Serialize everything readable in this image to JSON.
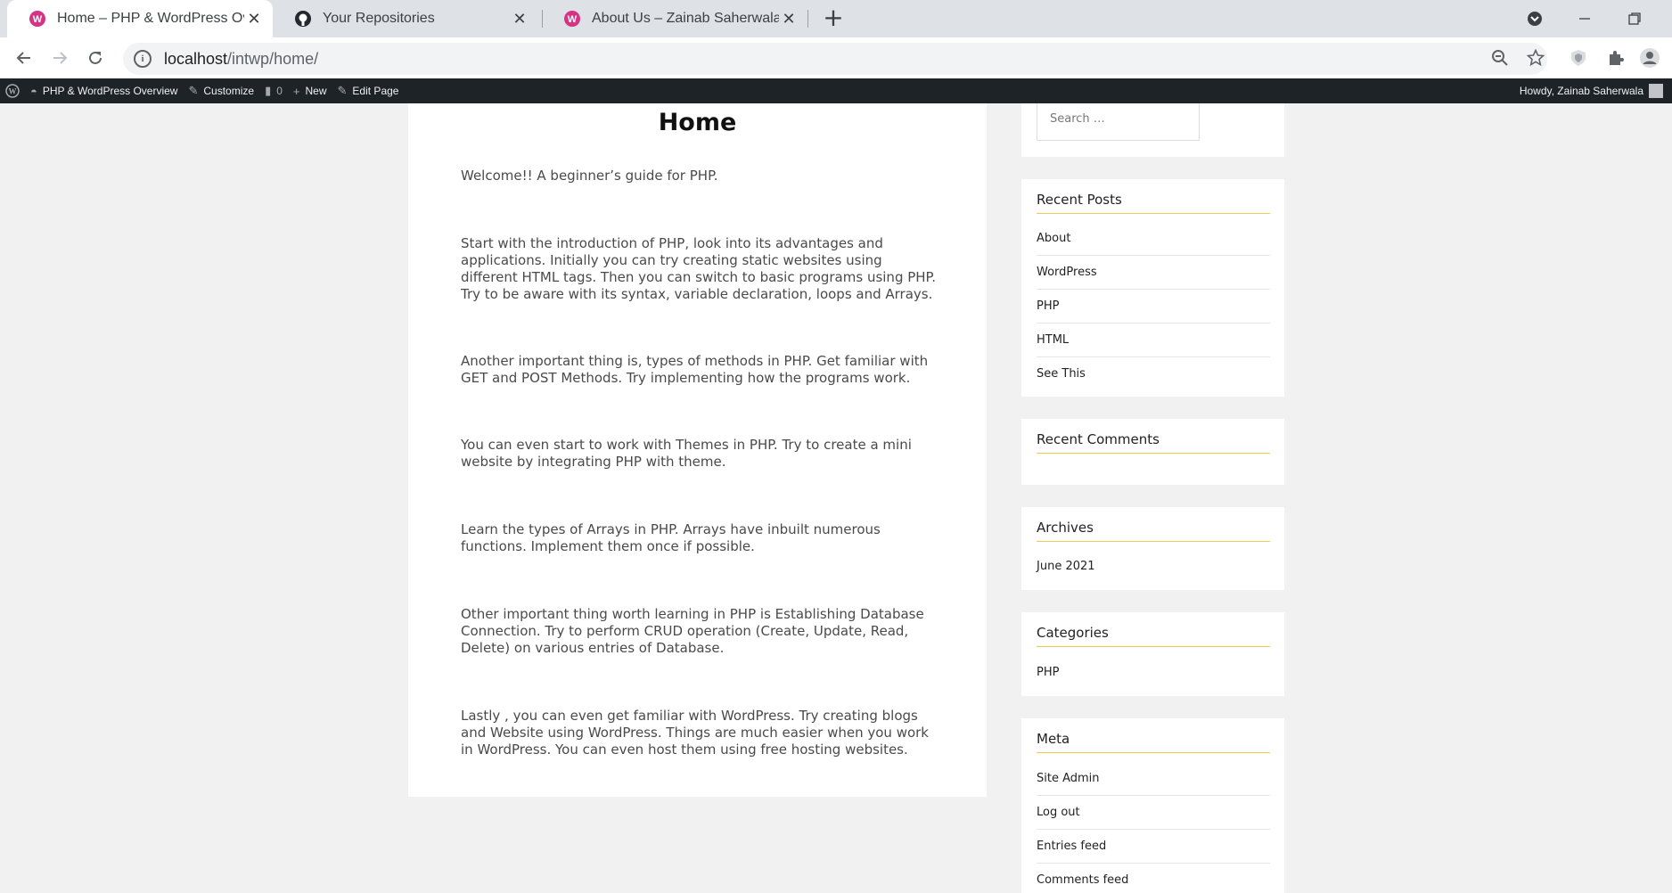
{
  "browser": {
    "tabs": [
      {
        "title": "Home – PHP & WordPress Overview",
        "icon": "wordpress-favicon-icon",
        "active": true
      },
      {
        "title": "Your Repositories",
        "icon": "github-icon",
        "active": false
      },
      {
        "title": "About Us – Zainab Saherwala",
        "icon": "wordpress-favicon-icon",
        "active": false
      }
    ],
    "url_host": "localhost",
    "url_path": "/intwp/home/",
    "accent_color": "#d63384"
  },
  "adminbar": {
    "site_name": "PHP & WordPress Overview",
    "customize": "Customize",
    "comments_count": "0",
    "new": "New",
    "edit_page": "Edit Page",
    "howdy": "Howdy, Zainab Saherwala"
  },
  "page": {
    "title": "Home",
    "paragraphs": [
      "Welcome!! A beginner’s guide for PHP.",
      "Start with the introduction of PHP, look into its advantages and applications. Initially you can try creating static websites using different HTML tags. Then you can switch to basic programs using PHP. Try to be aware with its syntax, variable declaration, loops and Arrays.",
      "Another important thing is, types of methods in PHP. Get familiar with GET and POST Methods. Try implementing how the programs work.",
      "You can even start to work with Themes in PHP. Try to create a mini website by integrating PHP with theme.",
      "Learn the types of Arrays in PHP. Arrays have inbuilt numerous functions. Implement them once if possible.",
      "Other important thing worth learning in PHP is Establishing Database Connection. Try to perform CRUD operation (Create, Update, Read, Delete) on various entries of Database.",
      "Lastly , you can even get familiar with WordPress. Try creating blogs and Website using WordPress. Things are much easier when you work in WordPress. You can even host them using free hosting websites."
    ]
  },
  "sidebar": {
    "search_placeholder": "Search …",
    "recent_posts": {
      "title": "Recent Posts",
      "items": [
        "About",
        "WordPress",
        "PHP",
        "HTML",
        "See This"
      ]
    },
    "recent_comments": {
      "title": "Recent Comments"
    },
    "archives": {
      "title": "Archives",
      "items": [
        "June 2021"
      ]
    },
    "categories": {
      "title": "Categories",
      "items": [
        "PHP"
      ]
    },
    "meta": {
      "title": "Meta",
      "items": [
        "Site Admin",
        "Log out",
        "Entries feed",
        "Comments feed"
      ]
    }
  }
}
